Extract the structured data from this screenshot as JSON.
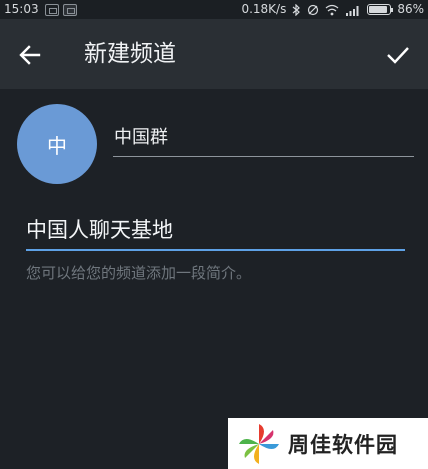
{
  "status_bar": {
    "time": "15:03",
    "speed": "0.18K/s",
    "battery": "86%",
    "battery_level_pct": 86
  },
  "app_bar": {
    "title": "新建频道",
    "back_icon": "arrow-back-icon",
    "confirm_icon": "check-icon"
  },
  "form": {
    "avatar_text": "中",
    "avatar_color": "#6a9ad6",
    "name_value": "中国群",
    "description_value": "中国人聊天基地",
    "description_hint": "您可以给您的频道添加一段简介。",
    "accent_color": "#5ea1e6"
  },
  "watermark": {
    "text": "周佳软件园"
  }
}
